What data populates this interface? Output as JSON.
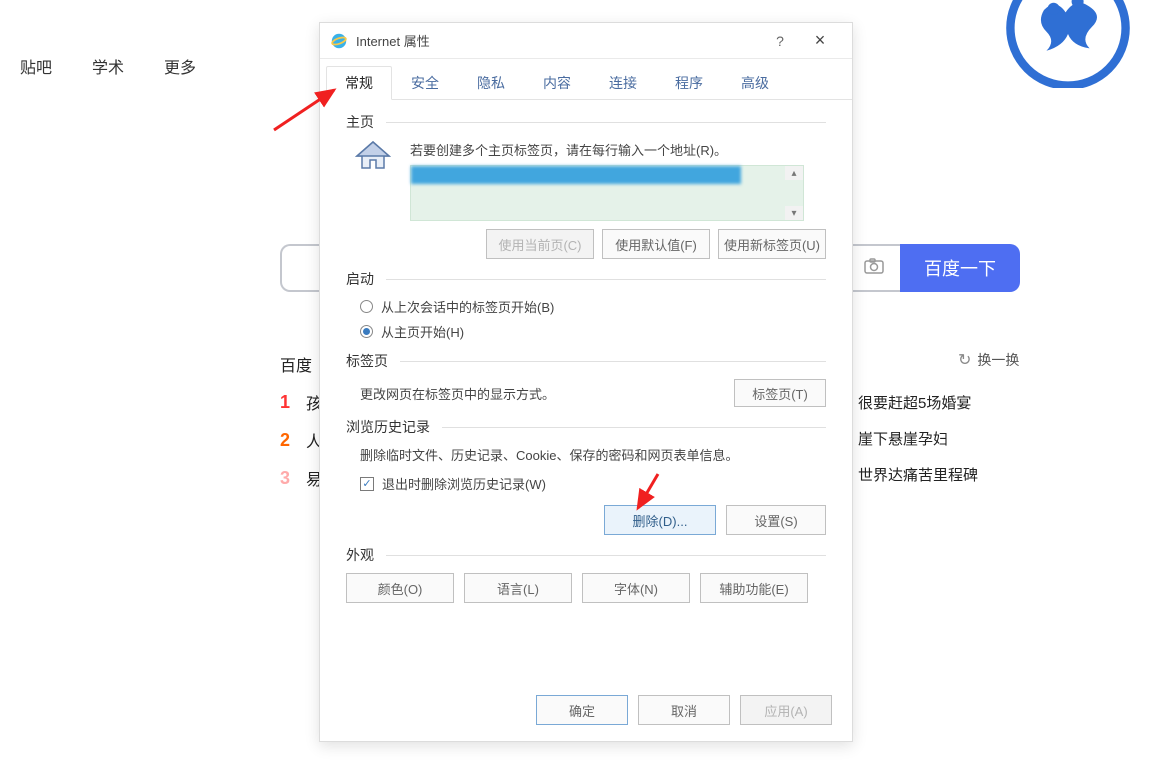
{
  "bg": {
    "nav": [
      "贴吧",
      "学术",
      "更多"
    ],
    "search_btn": "百度一下",
    "hot_label": "百度",
    "refresh": "换一换",
    "row1_txt": "孩",
    "row2_txt": "人",
    "row3_txt": "易",
    "side": [
      "很要赶超5场婚宴",
      "崖下悬崖孕妇",
      "世界达痛苦里程碑"
    ]
  },
  "dialog": {
    "title": "Internet 属性",
    "help": "?",
    "close": "×",
    "tabs": [
      "常规",
      "安全",
      "隐私",
      "内容",
      "连接",
      "程序",
      "高级"
    ],
    "homepage": {
      "title": "主页",
      "desc": "若要创建多个主页标签页，请在每行输入一个地址(R)。",
      "use_current": "使用当前页(C)",
      "use_default": "使用默认值(F)",
      "use_newtab": "使用新标签页(U)"
    },
    "startup": {
      "title": "启动",
      "opt1": "从上次会话中的标签页开始(B)",
      "opt2": "从主页开始(H)"
    },
    "tabpages": {
      "title": "标签页",
      "desc": "更改网页在标签页中的显示方式。",
      "btn": "标签页(T)"
    },
    "history": {
      "title": "浏览历史记录",
      "desc": "删除临时文件、历史记录、Cookie、保存的密码和网页表单信息。",
      "chk": "退出时删除浏览历史记录(W)",
      "delete": "删除(D)...",
      "settings": "设置(S)"
    },
    "appearance": {
      "title": "外观",
      "colors": "颜色(O)",
      "lang": "语言(L)",
      "fonts": "字体(N)",
      "access": "辅助功能(E)"
    },
    "footer": {
      "ok": "确定",
      "cancel": "取消",
      "apply": "应用(A)"
    }
  }
}
